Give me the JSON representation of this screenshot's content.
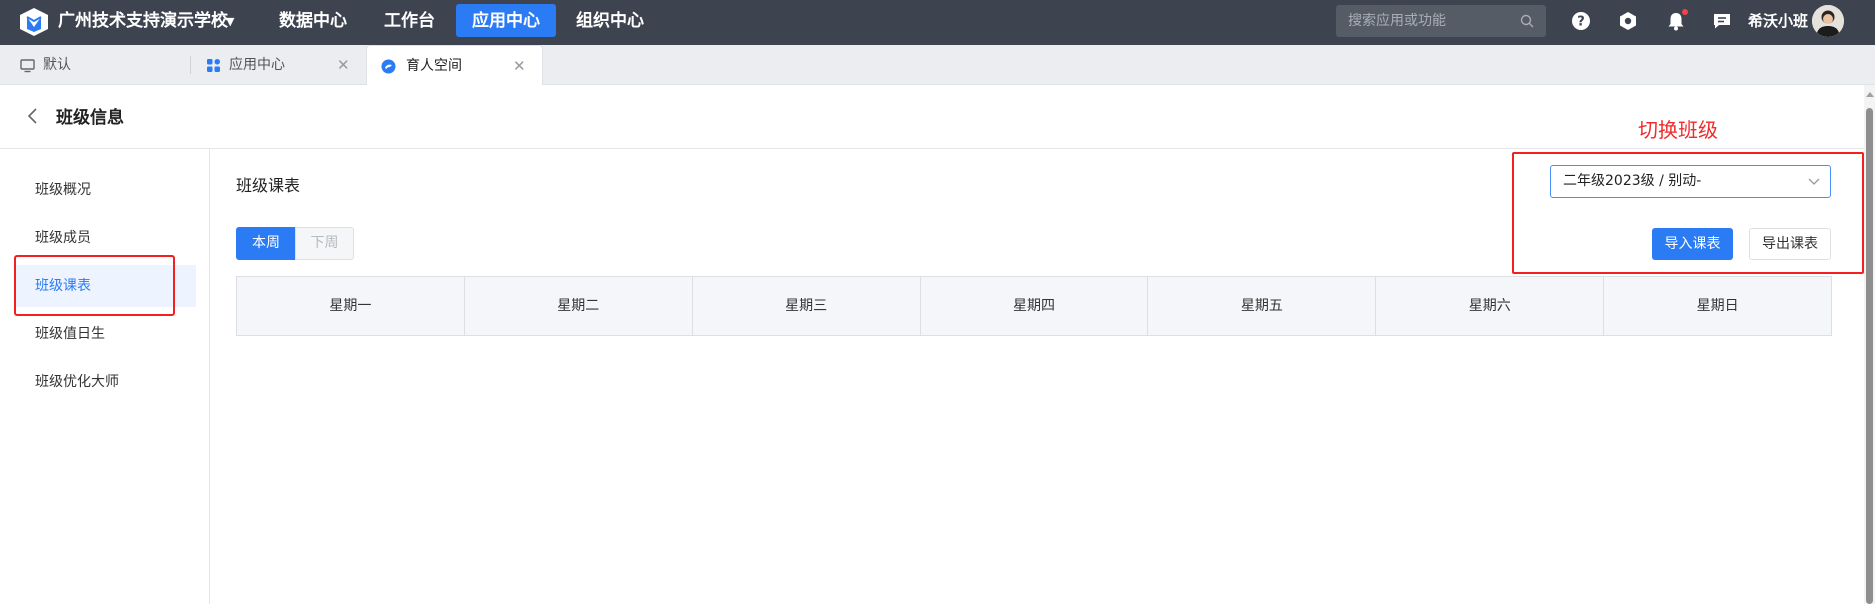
{
  "topbar": {
    "school_name": "广州技术支持演示学校",
    "nav": [
      "数据中心",
      "工作台",
      "应用中心",
      "组织中心"
    ],
    "active_nav": "应用中心",
    "search_placeholder": "搜索应用或功能",
    "user_name": "希沃小班"
  },
  "tabs": [
    {
      "label": "默认",
      "icon": "monitor-icon"
    },
    {
      "label": "应用中心",
      "icon": "apps-grid-icon"
    },
    {
      "label": "育人空间",
      "icon": "space-app-icon"
    }
  ],
  "page": {
    "title": "班级信息",
    "annotation": "切换班级"
  },
  "sidemenu": {
    "items": [
      "班级概况",
      "班级成员",
      "班级课表",
      "班级值日生",
      "班级优化大师"
    ],
    "active": "班级课表"
  },
  "main": {
    "section_title": "班级课表",
    "class_select_value": "二年级2023级 / 别动-",
    "week_tabs": [
      "本周",
      "下周"
    ],
    "active_week": "本周",
    "import_button": "导入课表",
    "export_button": "导出课表",
    "timetable_headers": [
      "星期一",
      "星期二",
      "星期三",
      "星期四",
      "星期五",
      "星期六",
      "星期日"
    ]
  },
  "colors": {
    "topbar_bg": "#3d4450",
    "accent": "#2b7bf4",
    "annotation_red": "#f02b2b"
  }
}
